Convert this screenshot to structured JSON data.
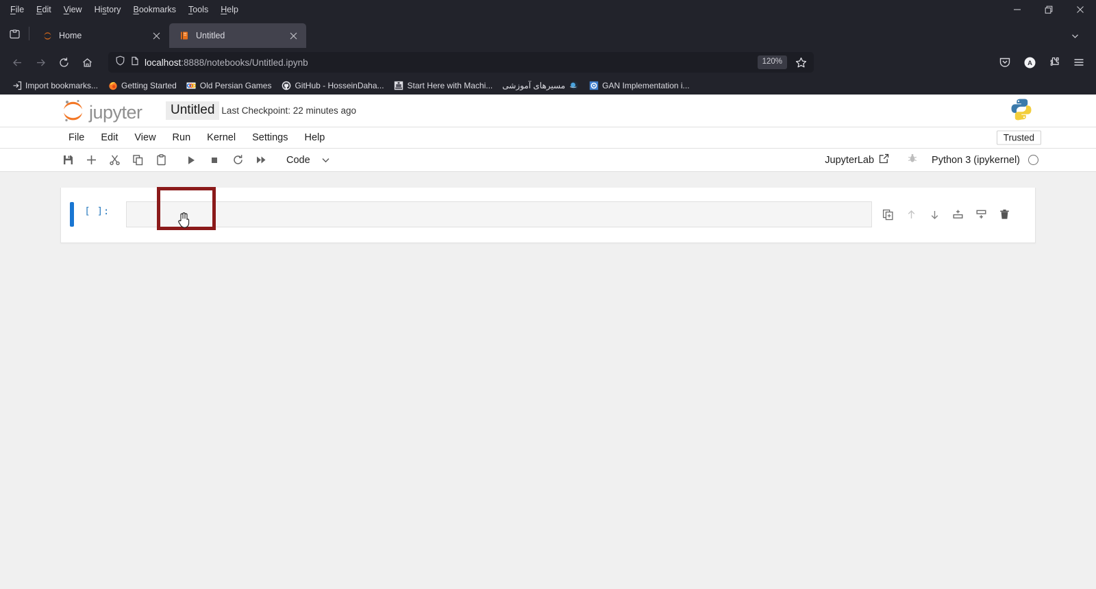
{
  "browser": {
    "menubar": [
      {
        "label": "File",
        "mnemonic": "F"
      },
      {
        "label": "Edit",
        "mnemonic": "E"
      },
      {
        "label": "View",
        "mnemonic": "V"
      },
      {
        "label": "History",
        "mnemonic": "s"
      },
      {
        "label": "Bookmarks",
        "mnemonic": "B"
      },
      {
        "label": "Tools",
        "mnemonic": "T"
      },
      {
        "label": "Help",
        "mnemonic": "H"
      }
    ],
    "window_controls": {
      "minimize": "minimize-icon",
      "restore": "restore-icon",
      "close": "close-icon"
    },
    "tabs": [
      {
        "title": "Home",
        "favicon": "jupyter-favicon",
        "active": false
      },
      {
        "title": "Untitled",
        "favicon": "notebook-favicon",
        "active": true
      }
    ],
    "list_all_tabs_icon": "list-all-tabs-icon",
    "nav": {
      "back": "back-arrow-icon",
      "forward": "forward-arrow-icon",
      "reload": "reload-icon",
      "home": "home-icon"
    },
    "urlbar": {
      "shield_icon": "tracking-protection-shield-icon",
      "page_icon": "page-info-icon",
      "url_host": "localhost",
      "url_rest": ":8888/notebooks/Untitled.ipynb",
      "zoom_level": "120%",
      "bookmark_star": "bookmark-star-icon"
    },
    "toolbar_icons": [
      {
        "name": "pocket-icon"
      },
      {
        "name": "firefox-account-avatar"
      },
      {
        "name": "extensions-puzzle-icon"
      },
      {
        "name": "app-menu-hamburger-icon"
      }
    ],
    "account_avatar_letter": "A",
    "bookmarks": [
      {
        "label": "Import bookmarks...",
        "icon": "import-bookmarks-icon",
        "rtl": false
      },
      {
        "label": "Getting Started",
        "icon": "firefox-icon",
        "rtl": false
      },
      {
        "label": "Old Persian Games",
        "icon": "games-icon",
        "rtl": false
      },
      {
        "label": "GitHub - HosseinDaha...",
        "icon": "github-icon",
        "rtl": false
      },
      {
        "label": "Start Here with Machi...",
        "icon": "machine-learning-icon",
        "rtl": false
      },
      {
        "label": "مسیرهای آموزشی",
        "icon": "globe-icon",
        "rtl": true
      },
      {
        "label": "GAN Implementation i...",
        "icon": "gan-icon",
        "rtl": false
      }
    ]
  },
  "jupyter": {
    "logo_text": "jupyter",
    "notebook_title": "Untitled",
    "checkpoint": "Last Checkpoint: 22 minutes ago",
    "python_logo": "python-logo",
    "trusted_badge": "Trusted",
    "menus": [
      "File",
      "Edit",
      "View",
      "Run",
      "Kernel",
      "Settings",
      "Help"
    ],
    "toolbar": {
      "buttons": [
        {
          "name": "save-button",
          "icon": "save-icon"
        },
        {
          "name": "insert-cell-button",
          "icon": "plus-icon"
        },
        {
          "name": "cut-cell-button",
          "icon": "scissors-icon"
        },
        {
          "name": "copy-cell-button",
          "icon": "copy-icon"
        },
        {
          "name": "paste-cell-button",
          "icon": "clipboard-icon"
        },
        {
          "name": "run-cell-button",
          "icon": "play-icon"
        },
        {
          "name": "stop-kernel-button",
          "icon": "stop-square-icon"
        },
        {
          "name": "restart-kernel-button",
          "icon": "restart-circular-arrow-icon"
        },
        {
          "name": "restart-and-run-all-button",
          "icon": "fast-forward-icon"
        }
      ],
      "cell_type": "Code",
      "cell_type_chevron": "chevron-down-icon",
      "jupyterlab_label": "JupyterLab",
      "jupyterlab_icon": "external-link-icon",
      "debugger_icon": "bug-icon",
      "kernel_name": "Python 3 (ipykernel)",
      "kernel_status_icon": "kernel-idle-circle-icon"
    },
    "cell": {
      "prompt": "[ ]:",
      "content": "",
      "tools": [
        {
          "name": "duplicate-cell-button",
          "icon": "duplicate-icon"
        },
        {
          "name": "move-cell-up-button",
          "icon": "arrow-up-icon",
          "disabled": true
        },
        {
          "name": "move-cell-down-button",
          "icon": "arrow-down-icon",
          "disabled": false
        },
        {
          "name": "insert-cell-above-button",
          "icon": "insert-above-icon"
        },
        {
          "name": "insert-cell-below-button",
          "icon": "insert-below-icon"
        },
        {
          "name": "delete-cell-button",
          "icon": "trash-icon"
        }
      ]
    }
  },
  "annotation": {
    "color": "#8b1a1a",
    "target": "notebook-title-highlight",
    "cursor": "pointing-hand-cursor"
  }
}
